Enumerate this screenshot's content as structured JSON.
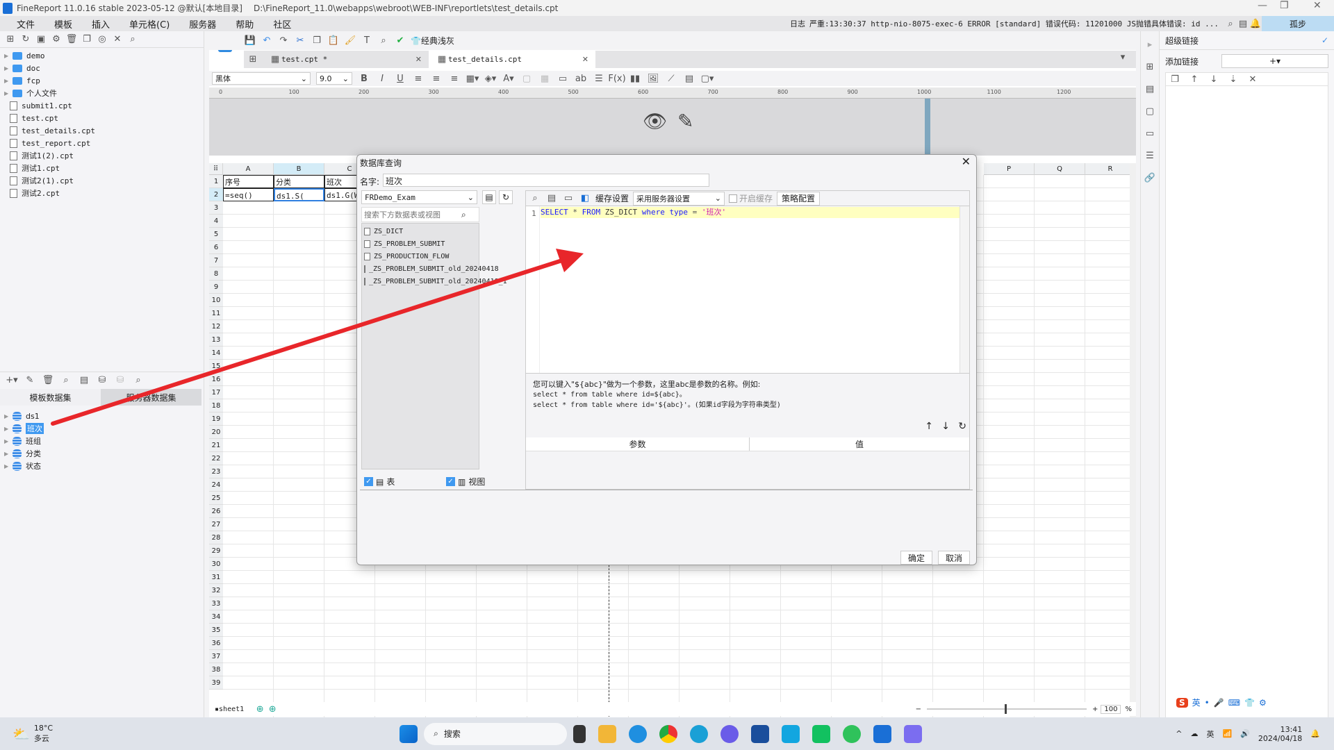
{
  "window": {
    "title": "FineReport 11.0.16 stable 2023-05-12 @默认[本地目录]",
    "path": "D:\\FineReport_11.0\\webapps\\webroot\\WEB-INF\\reportlets\\test_details.cpt"
  },
  "menu": [
    "文件",
    "模板",
    "插入",
    "单元格(C)",
    "服务器",
    "帮助",
    "社区"
  ],
  "log": {
    "label": "日志",
    "message": "严重:13:30:37 http-nio-8075-exec-6 ERROR [standard] 错误代码: 11201000 JS抛错具体错误: id ...",
    "lonely": "孤步"
  },
  "toolbar": {
    "classic_label": "经典浅灰"
  },
  "tabs": [
    {
      "label": "test.cpt *"
    },
    {
      "label": "test_details.cpt"
    }
  ],
  "format": {
    "font": "黑体",
    "size": "9.0"
  },
  "ruler": [
    "0",
    "100",
    "200",
    "300",
    "400",
    "500",
    "600",
    "700",
    "800",
    "900",
    "1000",
    "1100",
    "1200"
  ],
  "file_tree": [
    {
      "label": "demo",
      "type": "folder"
    },
    {
      "label": "doc",
      "type": "folder"
    },
    {
      "label": "fcp",
      "type": "folder"
    },
    {
      "label": "个人文件",
      "type": "folder"
    },
    {
      "label": "submit1.cpt",
      "type": "file"
    },
    {
      "label": "test.cpt",
      "type": "file"
    },
    {
      "label": "test_details.cpt",
      "type": "file"
    },
    {
      "label": "test_report.cpt",
      "type": "file"
    },
    {
      "label": "测试1(2).cpt",
      "type": "file"
    },
    {
      "label": "测试1.cpt",
      "type": "file"
    },
    {
      "label": "测试2(1).cpt",
      "type": "file"
    },
    {
      "label": "测试2.cpt",
      "type": "file"
    }
  ],
  "dataset_tabs": [
    "模板数据集",
    "服务器数据集"
  ],
  "datasets": [
    "ds1",
    "班次",
    "班组",
    "分类",
    "状态"
  ],
  "selected_dataset": "班次",
  "grid": {
    "columns": [
      "A",
      "B",
      "C",
      "P",
      "Q",
      "R"
    ],
    "cells": {
      "A1": "序号",
      "B1": "分类",
      "C1": "班次",
      "A2": "=seq()",
      "B2": "ds1.S(",
      "C2": "ds1.G(W"
    }
  },
  "sheet": {
    "name": "sheet1",
    "zoom": "100",
    "zoom_unit": "%"
  },
  "right_panel": {
    "title": "超级链接",
    "add_label": "添加链接"
  },
  "dialog": {
    "title": "数据库查询",
    "name_label": "名字:",
    "name_value": "班次",
    "connection": "FRDemo_Exam",
    "search_placeholder": "搜索下方数据表或视图",
    "tables": [
      "ZS_DICT",
      "ZS_PROBLEM_SUBMIT",
      "ZS_PRODUCTION_FLOW",
      "_ZS_PROBLEM_SUBMIT_old_20240418",
      "_ZS_PROBLEM_SUBMIT_old_20240418_1"
    ],
    "cache_label": "缓存设置",
    "cache_option": "采用服务器设置",
    "enable_cache": "开启缓存",
    "enable_cache_checked": false,
    "strategy_label": "策略配置",
    "sql_line": "1",
    "sql": [
      {
        "t": "SELECT",
        "c": "#1a1aff"
      },
      {
        "t": " * ",
        "c": "#555"
      },
      {
        "t": "FROM",
        "c": "#1a1aff"
      },
      {
        "t": " ZS_DICT ",
        "c": "#333"
      },
      {
        "t": "where",
        "c": "#1a1aff"
      },
      {
        "t": " ",
        "c": "#333"
      },
      {
        "t": "type",
        "c": "#1a1aff"
      },
      {
        "t": " = ",
        "c": "#555"
      },
      {
        "t": "'班次'",
        "c": "#d01fb0"
      }
    ],
    "hint": [
      "您可以键入\"${abc}\"做为一个参数，这里abc是参数的名称。例如:",
      "select * from table where id=${abc}。",
      "select * from table where id='${abc}'。(如果id字段为字符串类型)"
    ],
    "param_headers": [
      "参数",
      "值"
    ],
    "show_tables": {
      "label": "表",
      "checked": true
    },
    "show_views": {
      "label": "视图",
      "checked": true
    },
    "ok": "确定",
    "cancel": "取消"
  },
  "taskbar": {
    "weather_temp": "18°C",
    "weather_desc": "多云",
    "search": "搜索",
    "time": "13:41",
    "date": "2024/04/18",
    "ime": "英"
  },
  "colors": {
    "accent": "#3f99f0",
    "annotation_arrow": "#e8262a",
    "sql_highlight": "#ffffc0"
  }
}
